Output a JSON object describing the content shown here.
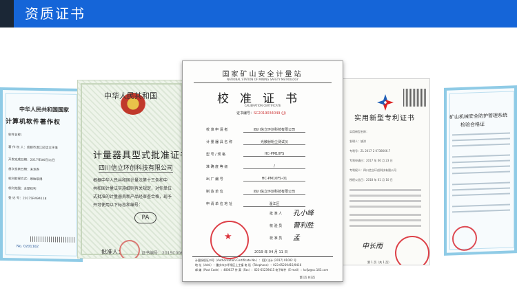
{
  "header": {
    "title": "资质证书"
  },
  "certificates": {
    "software_copyright": {
      "heading": "中华人民共和国国家",
      "title": "计算机软件著作权",
      "rows": [
        "软件名称：",
        "著 作 权 人：成都市温江区信立环境",
        "开发完成日期：2017年06月11日",
        "首次发表日期：未发表",
        "权利取得方式：原始取得",
        "权利范围：全部权利",
        "登 记 号：2017SR494118"
      ],
      "number": "No. 0201182"
    },
    "pattern_approval": {
      "heading": "中华人民共和国",
      "title": "计量器具型式批准证书",
      "company": "四川信立环创科技有限公司",
      "body_lines": [
        "根据中华人民共和国计量法第十三条和中",
        "共和国计量法实施细则有关规定，对你单位",
        "式批准的计量器具新产品经审查合格，现予",
        "开可使用以下标志和编号："
      ],
      "mark": "PA",
      "issuer": "批准人：",
      "cert_no": "证书编号：2015C006-"
    },
    "calibration": {
      "org": "国家矿山安全计量站",
      "org_en": "NATIONAL STATION OF MINING SAFETY METROLOGY",
      "title": "校准证书",
      "title_en": "CALIBRATION CERTIFICATE",
      "cert_no_label": "证书编号：",
      "cert_no": "SC2019034049 (JJ)",
      "fields": [
        {
          "label": "校 准 申 请 者",
          "value": "四川信立环创科技有限公司"
        },
        {
          "label": "计 量 器 具 名 称",
          "value": "光散射粉尘测试仪"
        },
        {
          "label": "型 号 / 规 格",
          "value": "HC-PM10FS"
        },
        {
          "label": "准 确 度 等 级",
          "value": "/"
        },
        {
          "label": "出 厂 编 号",
          "value": "HC-PM10FS-01"
        },
        {
          "label": "制 造 单 位",
          "value": "四川信立环创科技有限公司"
        },
        {
          "label": "申 请 单 位 地 址",
          "value": "温江区"
        }
      ],
      "signers": [
        {
          "label": "批 准 人",
          "name": "孔小峰"
        },
        {
          "label": "核 验 员",
          "name": "曹利胜"
        },
        {
          "label": "校 准 员",
          "name": "孟"
        }
      ],
      "date": "2019 年 04 月 11 日",
      "footer_lines": [
        "计量授权证书号（Authorization Certificate No.）：(国) 法计 (2017) 01002 号",
        "地 址（Add.）：重庆市沙坪坝区土主镇 电 话（Telephone）：023-65239415/9416",
        "邮 编（Post Code）：400037 传 真（Fax）：023-65239415 电子邮件（E-mail）：kcfjz@cc.163.com"
      ],
      "page": "第1页 共2页"
    },
    "patent": {
      "title": "实用新型专利证书",
      "lines": [
        "实用新型名称：",
        "发明人：姚洪",
        "专利号：ZL 2017 2 0738666.7",
        "专利申请日：2017 年 06 月 23 日",
        "专利权人：四川信立环创科技有限公司",
        "授权公告日：2018 年 01 月 10 日"
      ],
      "signature": "申长雨",
      "page": "第 1 页（共 1 页）"
    },
    "safety_system": {
      "title_1": "矿山机械安全防护管理系统",
      "title_2": "检验合格证"
    }
  }
}
